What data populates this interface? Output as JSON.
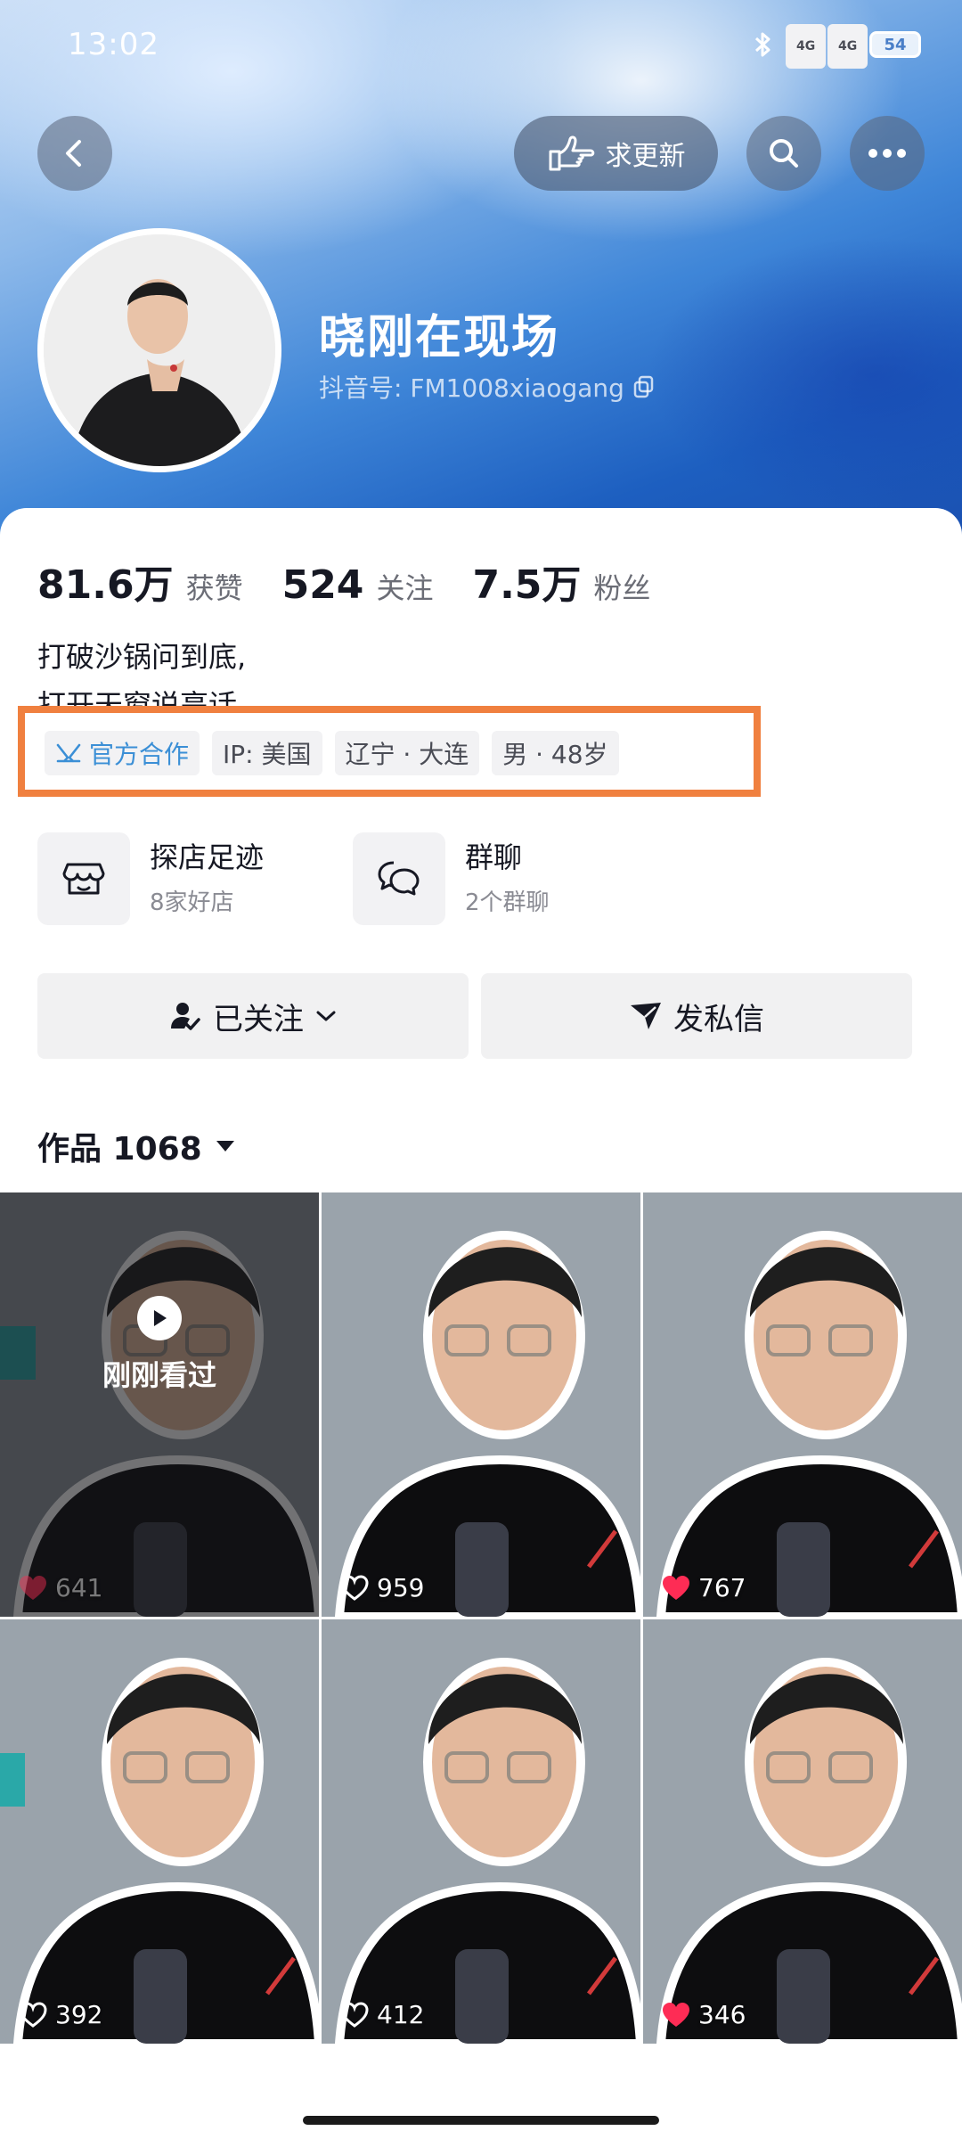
{
  "status_bar": {
    "time": "13:02",
    "network_1": "4G",
    "network_2": "4G",
    "battery": "54"
  },
  "header": {
    "request_update_label": "求更新",
    "icons": [
      "back-arrow-icon",
      "hand-point-icon",
      "search-icon",
      "more-icon"
    ]
  },
  "profile": {
    "name": "晓刚在现场",
    "douyin_id": "抖音号: FM1008xiaogang"
  },
  "stats": [
    {
      "value": "81.6万",
      "label": "获赞"
    },
    {
      "value": "524",
      "label": "关注"
    },
    {
      "value": "7.5万",
      "label": "粉丝"
    }
  ],
  "bio": {
    "line1": "打破沙锅问到底,",
    "line2": "打开天窗说亮话"
  },
  "tags": {
    "official": "官方合作",
    "ip": "IP: 美国",
    "location": "辽宁 · 大连",
    "gender_age": "男 · 48岁"
  },
  "features": {
    "shop": {
      "title": "探店足迹",
      "sub": "8家好店"
    },
    "group": {
      "title": "群聊",
      "sub": "2个群聊"
    }
  },
  "actions": {
    "following": "已关注",
    "message": "发私信"
  },
  "works": {
    "label": "作品 1068"
  },
  "videos": [
    {
      "likes": "641",
      "watched": true,
      "watched_label": "刚刚看过",
      "liked": true
    },
    {
      "likes": "959",
      "watched": false,
      "liked": false
    },
    {
      "likes": "767",
      "watched": false,
      "liked": true
    },
    {
      "likes": "392",
      "watched": false,
      "liked": false
    },
    {
      "likes": "412",
      "watched": false,
      "liked": false
    },
    {
      "likes": "346",
      "watched": false,
      "liked": true
    }
  ],
  "colors": {
    "highlight_border": "#f0803f",
    "official_tag": "#3b8fd6",
    "liked_heart": "#fe2c55"
  }
}
